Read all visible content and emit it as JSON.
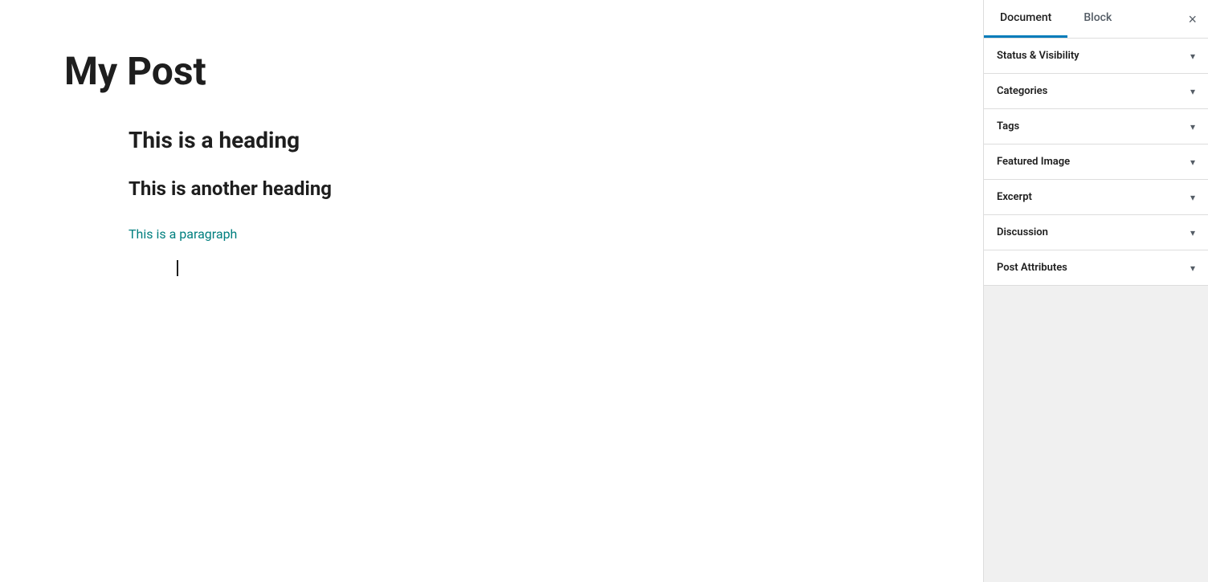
{
  "editor": {
    "title": "My Post",
    "heading1": "This is a heading",
    "heading2": "This is another heading",
    "paragraph": "This is a paragraph"
  },
  "sidebar": {
    "tab_document": "Document",
    "tab_block": "Block",
    "close_label": "×",
    "sections": [
      {
        "id": "status-visibility",
        "label": "Status & Visibility"
      },
      {
        "id": "categories",
        "label": "Categories"
      },
      {
        "id": "tags",
        "label": "Tags"
      },
      {
        "id": "featured-image",
        "label": "Featured Image"
      },
      {
        "id": "excerpt",
        "label": "Excerpt"
      },
      {
        "id": "discussion",
        "label": "Discussion"
      },
      {
        "id": "post-attributes",
        "label": "Post Attributes"
      }
    ]
  }
}
